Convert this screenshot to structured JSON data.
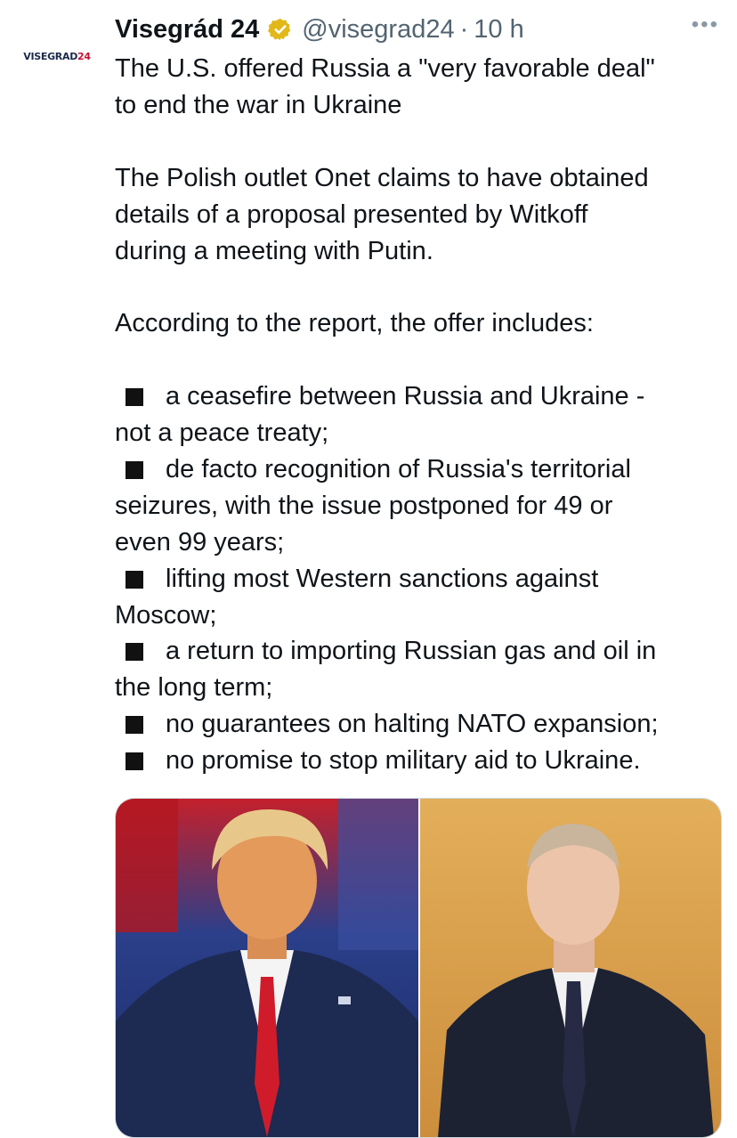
{
  "account": {
    "logo_text": "VISEGRAD",
    "logo_number": "24",
    "name": "Visegrád 24",
    "handle": "@visegrad24",
    "separator": "·",
    "time": "10 h",
    "more": "•••"
  },
  "tweet": {
    "lines": [
      "The U.S. offered Russia a \"very favorable deal\"",
      "to end the war in Ukraine",
      "The Polish outlet Onet claims to have obtained",
      "details of a proposal presented by Witkoff",
      "during a meeting with Putin.",
      "According to the report, the offer includes:",
      "a ceasefire between Russia and Ukraine -",
      "not a peace treaty;",
      "de facto recognition of Russia's territorial",
      "seizures, with the issue postponed for 49 or",
      "even 99 years;",
      "lifting most Western sanctions against",
      "Moscow;",
      "a return to importing Russian gas and oil in",
      "the long term;",
      "no guarantees on halting NATO expansion;",
      "no promise to stop military aid to Ukraine."
    ]
  },
  "media": {
    "left_photo": "trump-photo",
    "right_photo": "putin-photo"
  },
  "colors": {
    "text": "#0f1419",
    "muted": "#536471",
    "verified_gold": "#e2b719"
  }
}
